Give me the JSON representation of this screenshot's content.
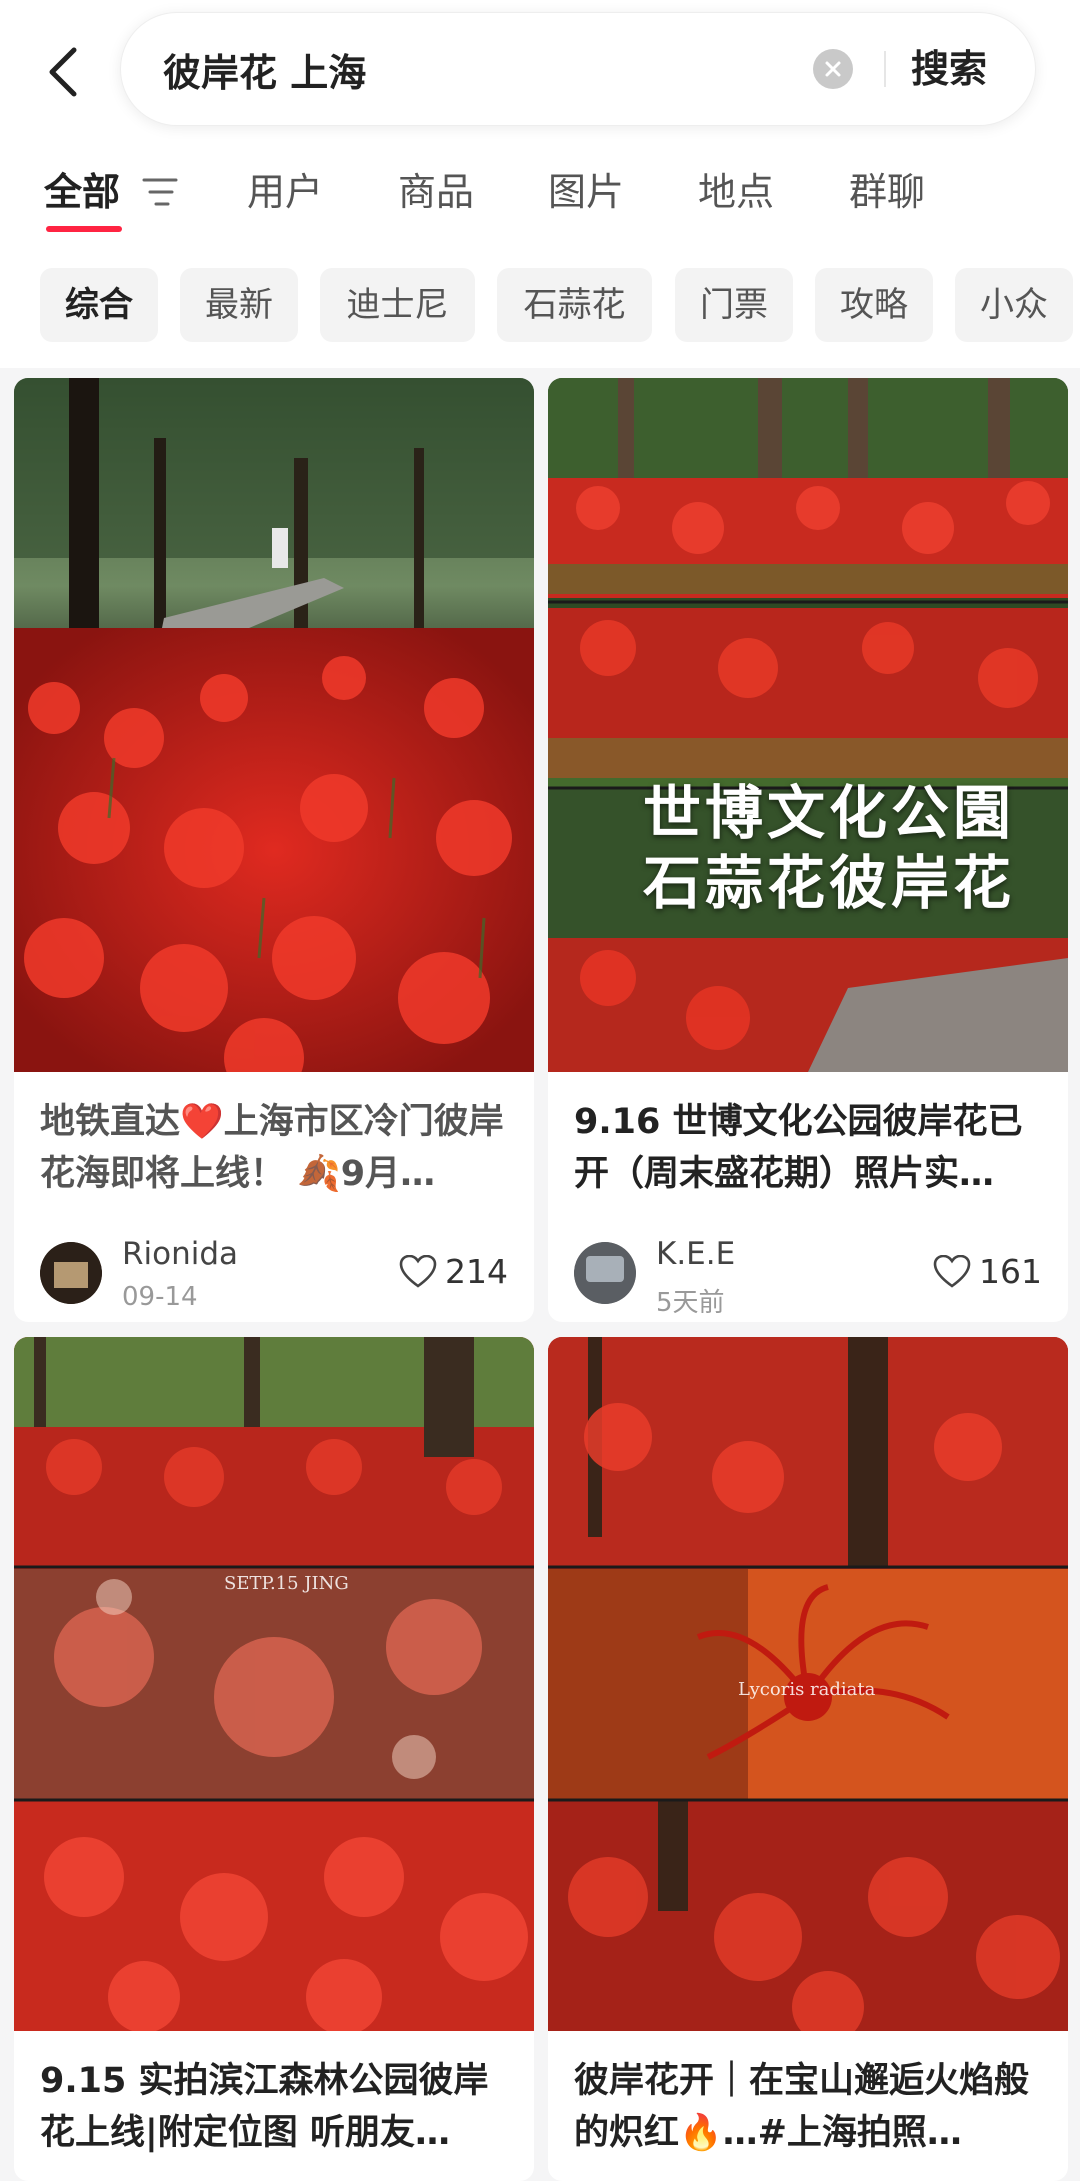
{
  "search": {
    "query": "彼岸花 上海",
    "submit_label": "搜索"
  },
  "tabs": [
    {
      "label": "全部",
      "active": true
    },
    {
      "label": "用户"
    },
    {
      "label": "商品"
    },
    {
      "label": "图片"
    },
    {
      "label": "地点"
    },
    {
      "label": "群聊"
    }
  ],
  "chips": [
    {
      "label": "综合",
      "active": true
    },
    {
      "label": "最新"
    },
    {
      "label": "迪士尼"
    },
    {
      "label": "石蒜花"
    },
    {
      "label": "门票"
    },
    {
      "label": "攻略"
    },
    {
      "label": "小众"
    }
  ],
  "colors": {
    "accent": "#ff2442",
    "flower_red": "#d8231c"
  },
  "cards": [
    {
      "title": "地铁直达❤️上海市区冷门彼岸花海即将上线！ 🍂9月…",
      "author": "Rionida",
      "date": "09-14",
      "likes": "214"
    },
    {
      "title": "9.16 世博文化公园彼岸花已开（周末盛花期）照片实…",
      "overlay_line1": "世博文化公園",
      "overlay_line2": "石蒜花彼岸花",
      "author": "K.E.E",
      "date": "5天前",
      "likes": "161"
    },
    {
      "title": "9.15 实拍滨江森林公园彼岸花上线|附定位图 听朋友…",
      "caption": "SETP.15 JING"
    },
    {
      "title": "彼岸花开｜在宝山邂逅火焰般的炽红🔥…#上海拍照…",
      "caption": "Lycoris radiata"
    }
  ]
}
